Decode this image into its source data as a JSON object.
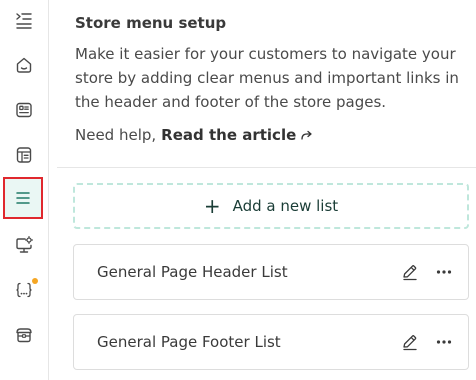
{
  "sidebar": {
    "items": [
      {
        "icon": "collapse-menu-icon"
      },
      {
        "icon": "home-icon"
      },
      {
        "icon": "product-card-icon"
      },
      {
        "icon": "pages-icon"
      },
      {
        "icon": "menu-list-icon",
        "active": true
      },
      {
        "icon": "monitor-settings-icon"
      },
      {
        "icon": "code-braces-icon",
        "notification": true
      },
      {
        "icon": "store-box-icon"
      }
    ],
    "active_color": "#e0282e",
    "notification_color": "#f5a623"
  },
  "header": {
    "title": "Store menu setup",
    "description": "Make it easier for your customers to navigate your store by adding clear menus and important links in the header and footer of the store pages.",
    "help_prefix": "Need help,",
    "help_link": "Read the article"
  },
  "add_list": {
    "icon": "+",
    "label": "Add a new list"
  },
  "lists": [
    {
      "label": "General Page Header List"
    },
    {
      "label": "General Page Footer List"
    }
  ]
}
